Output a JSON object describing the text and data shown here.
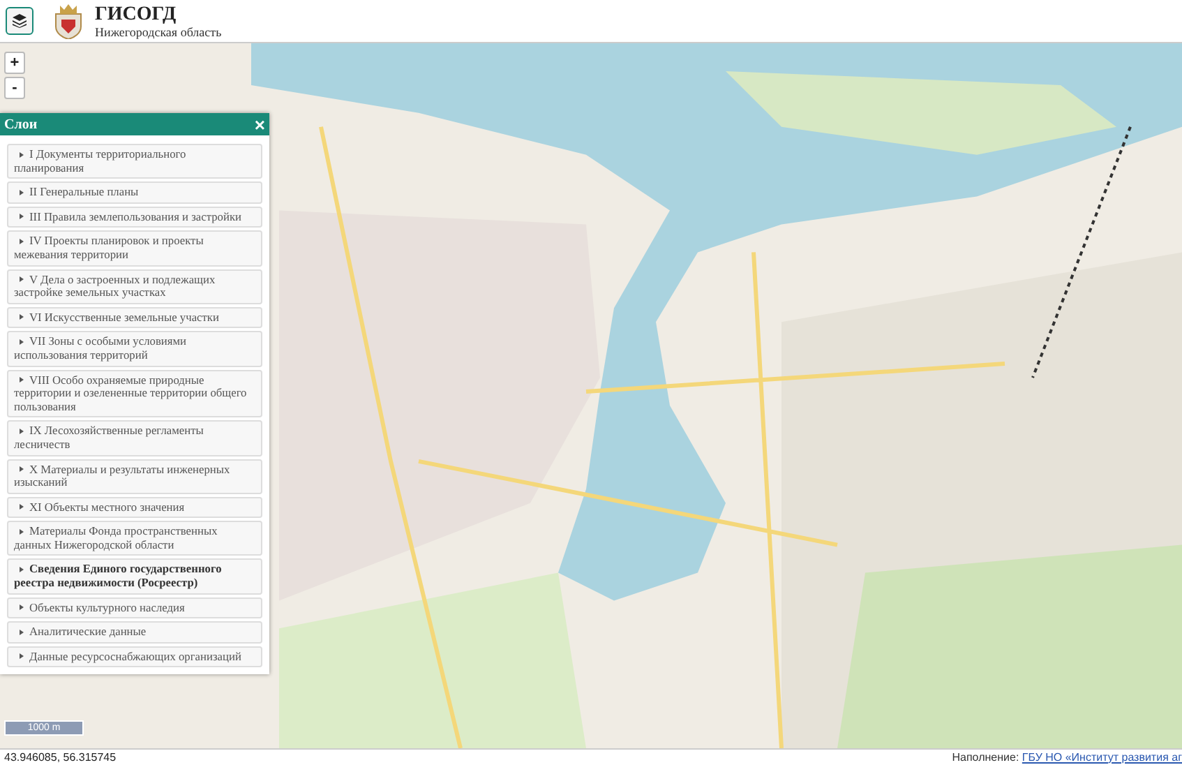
{
  "header": {
    "title": "ГИСОГД",
    "subtitle": "Нижегородская область"
  },
  "zoom_controls": [
    "+",
    "-"
  ],
  "layers_panel": {
    "title": "Слои",
    "close": "×",
    "items": [
      {
        "label": "I Документы территориального планирования",
        "bold": false
      },
      {
        "label": "II Генеральные планы",
        "bold": false
      },
      {
        "label": "III Правила землепользования и застройки",
        "bold": false
      },
      {
        "label": "IV Проекты планировок и проекты межевания территории",
        "bold": false
      },
      {
        "label": "V Дела о застроенных и подлежащих застройке земельных участках",
        "bold": false
      },
      {
        "label": "VI Искусственные земельные участки",
        "bold": false
      },
      {
        "label": "VII Зоны с особыми условиями использования территорий",
        "bold": false
      },
      {
        "label": "VIII Особо охраняемые природные территории и озелененные территории общего пользования",
        "bold": false
      },
      {
        "label": "IX Лесохозяйственные регламенты лесничеств",
        "bold": false
      },
      {
        "label": "X Материалы и результаты инженерных изысканий",
        "bold": false
      },
      {
        "label": "XI Объекты местного значения",
        "bold": false
      },
      {
        "label": "Материалы Фонда пространственных данных Нижегородской области",
        "bold": false
      },
      {
        "label": "Сведения Единого государственного реестра недвижимости (Росреестр)",
        "bold": true
      },
      {
        "label": "Объекты культурного наследия",
        "bold": false
      },
      {
        "label": "Аналитические данные",
        "bold": false
      },
      {
        "label": "Данные ресурсоснабжающих организаций",
        "bold": false
      }
    ]
  },
  "scale_bar": "1000 m",
  "status_bar": {
    "coordinates": "43.946085, 56.315745",
    "credit_label": "Наполнение:",
    "credit_link": "ГБУ НО «Институт развития аг"
  }
}
